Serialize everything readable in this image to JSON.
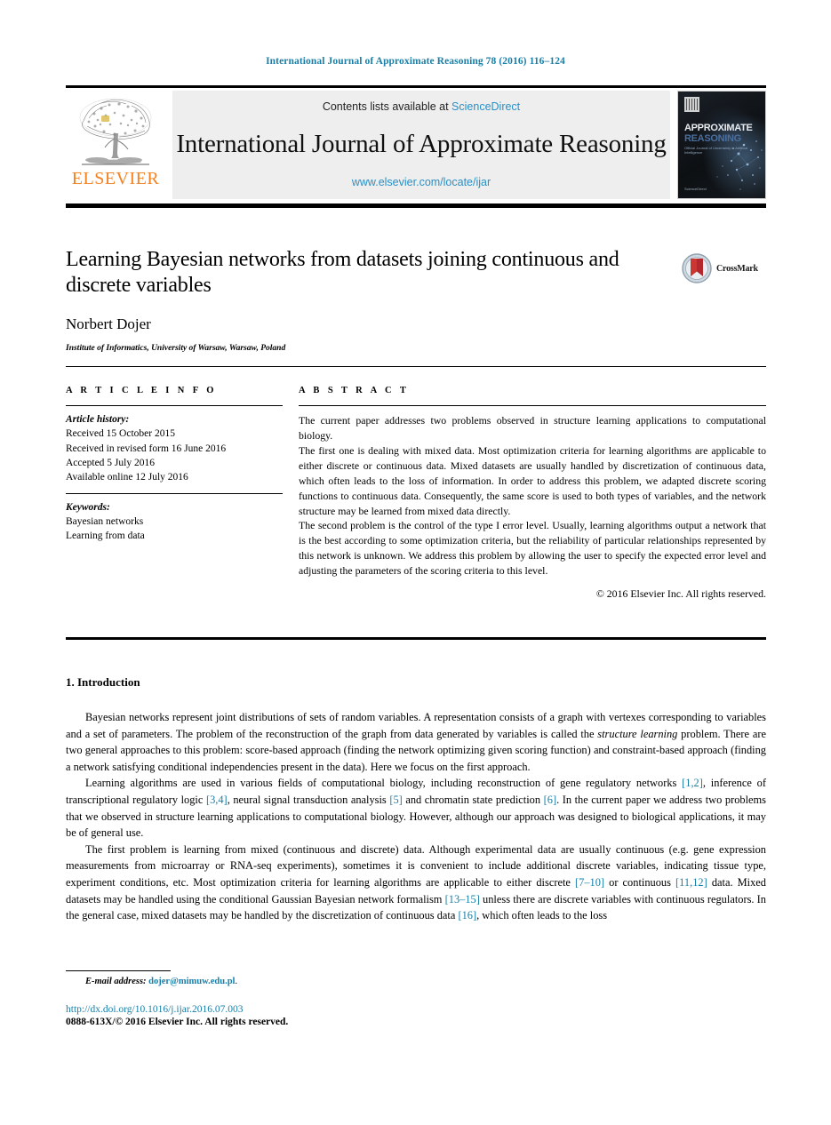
{
  "running_head": "International Journal of Approximate Reasoning 78 (2016) 116–124",
  "masthead": {
    "publisher_name": "ELSEVIER",
    "contents_prefix": "Contents lists available at ",
    "contents_link": "ScienceDirect",
    "journal_title": "International Journal of Approximate Reasoning",
    "journal_url": "www.elsevier.com/locate/ijar",
    "cover": {
      "title_main": "APPROXIMATE",
      "title_sub": "REASONING",
      "tagline": "Official Journal of Uncertainty in Artificial Intelligence",
      "footer": "ScienceDirect"
    }
  },
  "article": {
    "title": "Learning Bayesian networks from datasets joining continuous and discrete variables",
    "author": "Norbert Dojer",
    "affiliation": "Institute of Informatics, University of Warsaw, Warsaw, Poland",
    "crossmark_label": "CrossMark"
  },
  "article_info": {
    "heading": "A R T I C L E   I N F O",
    "history_label": "Article history:",
    "history": [
      "Received 15 October 2015",
      "Received in revised form 16 June 2016",
      "Accepted 5 July 2016",
      "Available online 12 July 2016"
    ],
    "keywords_label": "Keywords:",
    "keywords": [
      "Bayesian networks",
      "Learning from data"
    ]
  },
  "abstract": {
    "heading": "A B S T R A C T",
    "paragraphs": [
      "The current paper addresses two problems observed in structure learning applications to computational biology.",
      "The first one is dealing with mixed data. Most optimization criteria for learning algorithms are applicable to either discrete or continuous data. Mixed datasets are usually handled by discretization of continuous data, which often leads to the loss of information. In order to address this problem, we adapted discrete scoring functions to continuous data. Consequently, the same score is used to both types of variables, and the network structure may be learned from mixed data directly.",
      "The second problem is the control of the type I error level. Usually, learning algorithms output a network that is the best according to some optimization criteria, but the reliability of particular relationships represented by this network is unknown. We address this problem by allowing the user to specify the expected error level and adjusting the parameters of the scoring criteria to this level."
    ],
    "copyright": "© 2016 Elsevier Inc. All rights reserved."
  },
  "body": {
    "section_number_title": "1. Introduction",
    "paragraph_1_parts": [
      {
        "t": "Bayesian networks represent joint distributions of sets of random variables. A representation consists of a graph with vertexes corresponding to variables and a set of parameters. The problem of the reconstruction of the graph from data generated by variables is called the ",
        "k": "plain"
      },
      {
        "t": "structure learning",
        "k": "italic"
      },
      {
        "t": " problem. There are two general approaches to this problem: score-based approach (finding the network optimizing given scoring function) and constraint-based approach (finding a network satisfying conditional independencies present in the data). Here we focus on the first approach.",
        "k": "plain"
      }
    ],
    "paragraph_2_parts": [
      {
        "t": "Learning algorithms are used in various fields of computational biology, including reconstruction of gene regulatory networks ",
        "k": "plain"
      },
      {
        "t": "[1,2]",
        "k": "cite"
      },
      {
        "t": ", inference of transcriptional regulatory logic ",
        "k": "plain"
      },
      {
        "t": "[3,4]",
        "k": "cite"
      },
      {
        "t": ", neural signal transduction analysis ",
        "k": "plain"
      },
      {
        "t": "[5]",
        "k": "cite"
      },
      {
        "t": " and chromatin state prediction ",
        "k": "plain"
      },
      {
        "t": "[6]",
        "k": "cite"
      },
      {
        "t": ". In the current paper we address two problems that we observed in structure learning applications to computational biology. However, although our approach was designed to biological applications, it may be of general use.",
        "k": "plain"
      }
    ],
    "paragraph_3_parts": [
      {
        "t": "The first problem is learning from mixed (continuous and discrete) data. Although experimental data are usually continuous (e.g. gene expression measurements from microarray or RNA-seq experiments), sometimes it is convenient to include additional discrete variables, indicating tissue type, experiment conditions, etc. Most optimization criteria for learning algorithms are applicable to either discrete ",
        "k": "plain"
      },
      {
        "t": "[7–10]",
        "k": "cite"
      },
      {
        "t": " or continuous ",
        "k": "plain"
      },
      {
        "t": "[11,12]",
        "k": "cite"
      },
      {
        "t": " data. Mixed datasets may be handled using the conditional Gaussian Bayesian network formalism ",
        "k": "plain"
      },
      {
        "t": "[13–15]",
        "k": "cite"
      },
      {
        "t": " unless there are discrete variables with continuous regulators. In the general case, mixed datasets may be handled by the discretization of continuous data ",
        "k": "plain"
      },
      {
        "t": "[16]",
        "k": "cite"
      },
      {
        "t": ", which often leads to the loss",
        "k": "plain"
      }
    ]
  },
  "footer": {
    "email_label": "E-mail address:",
    "email": "dojer@mimuw.edu.pl",
    "email_suffix": ".",
    "doi": "http://dx.doi.org/10.1016/j.ijar.2016.07.003",
    "issn": "0888-613X/© 2016 Elsevier Inc. All rights reserved."
  },
  "colors": {
    "link_blue": "#1a7fa8",
    "sciencedirect_blue": "#2b8fc4",
    "elsevier_orange": "#f58220"
  }
}
